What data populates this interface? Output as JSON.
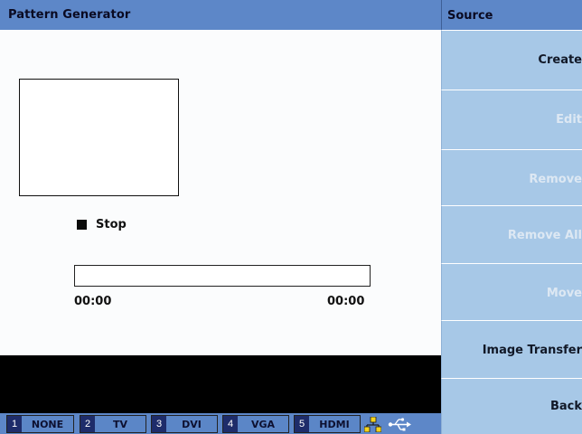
{
  "window": {
    "title": "Pattern Generator"
  },
  "playback": {
    "status": "Stop",
    "progress": 0,
    "elapsed": "00:00",
    "total": "00:00"
  },
  "channels": [
    {
      "num": "1",
      "label": "NONE"
    },
    {
      "num": "2",
      "label": "TV"
    },
    {
      "num": "3",
      "label": "DVI"
    },
    {
      "num": "4",
      "label": "VGA"
    },
    {
      "num": "5",
      "label": "HDMI"
    }
  ],
  "status_icons": [
    "network-icon",
    "usb-icon"
  ],
  "menu": {
    "title": "Source",
    "items": [
      {
        "label": "Create",
        "enabled": true
      },
      {
        "label": "Edit",
        "enabled": false
      },
      {
        "label": "Remove",
        "enabled": false
      },
      {
        "label": "Remove All",
        "enabled": false
      },
      {
        "label": "Move",
        "enabled": false
      },
      {
        "label": "Image Transfer",
        "enabled": true
      },
      {
        "label": "Back",
        "enabled": true
      }
    ]
  },
  "colors": {
    "header": "#5d87c8",
    "menu_bg": "#a7c8e7",
    "channel_number_bg": "#1e2c6a",
    "disabled_text": "#dde8f3"
  }
}
